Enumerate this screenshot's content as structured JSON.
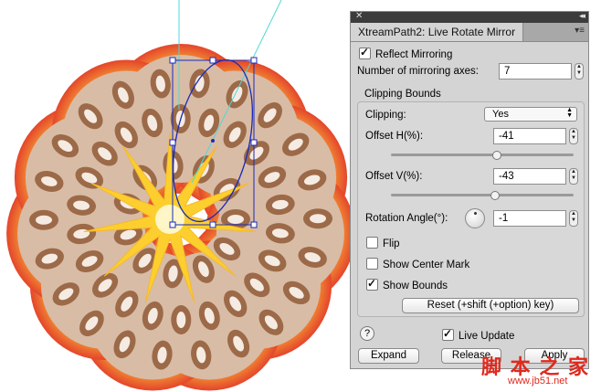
{
  "panel": {
    "title": "XtreamPath2: Live Rotate Mirror",
    "close_glyph": "✕",
    "collapse_glyph": "◂◂",
    "menu_glyph": "▾≡",
    "reflect_mirroring": {
      "label": "Reflect Mirroring",
      "checked": true
    },
    "axes": {
      "label": "Number of mirroring axes:",
      "value": "7"
    },
    "clipping_bounds": {
      "title": "Clipping Bounds",
      "clipping": {
        "label": "Clipping:",
        "value": "Yes"
      },
      "offset_h": {
        "label": "Offset H(%):",
        "value": "-41",
        "slider": 0.58
      },
      "offset_v": {
        "label": "Offset V(%):",
        "value": "-43",
        "slider": 0.57
      },
      "rotation": {
        "label": "Rotation Angle(°):",
        "value": "-1"
      },
      "flip": {
        "label": "Flip",
        "checked": false
      },
      "show_center_mark": {
        "label": "Show Center Mark",
        "checked": false
      },
      "show_bounds": {
        "label": "Show Bounds",
        "checked": true
      },
      "reset_label": "Reset (+shift (+option) key)"
    },
    "help_glyph": "?",
    "live_update": {
      "label": "Live Update",
      "checked": true
    },
    "expand_label": "Expand",
    "release_label": "Release",
    "apply_label": "Apply"
  },
  "watermark": {
    "text": "脚 本 之 家",
    "url": "www.jb51.net"
  },
  "colors": {
    "petal_outer": "#e8452a",
    "petal_inner": "#f5a623",
    "ornament": "#9c6a48",
    "star": "#fdd835",
    "path": "#1a2ab8",
    "guide": "#4fd8d8"
  }
}
